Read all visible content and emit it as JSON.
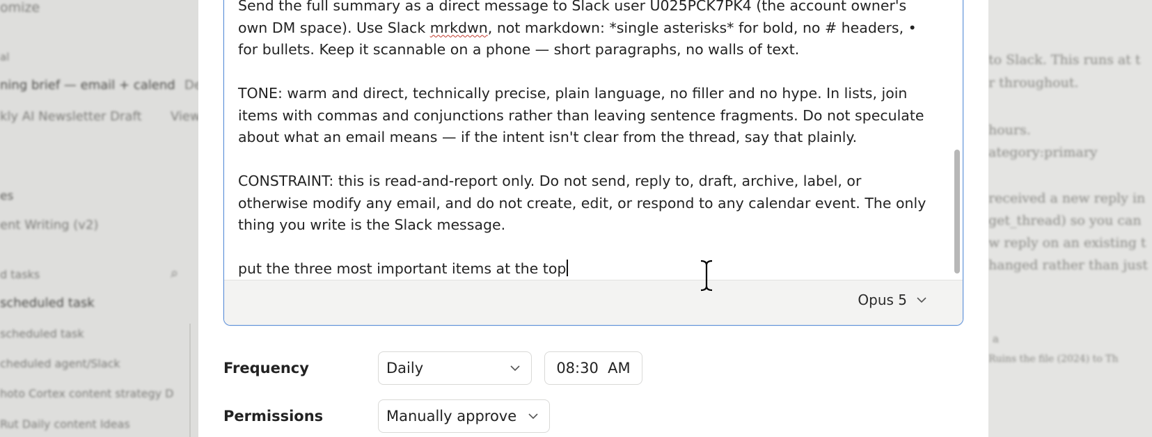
{
  "background": {
    "left_texts": [
      "omize",
      "al",
      "ning brief — email + calend",
      "De",
      "kly AI Newsletter Draft",
      "View",
      "es",
      "ent Writing (v2)",
      "d tasks",
      "scheduled task",
      "scheduled task",
      "cheduled agent/Slack",
      "hoto Cortex content strategy D",
      "Rut Daily content Ideas"
    ],
    "right_texts": [
      "to Slack. This runs at t",
      "r throughout.",
      "hours.",
      "ategory:primary",
      "received a new reply in",
      "get_thread) so you can",
      "w reply on an existing t",
      "hanged rather than just",
      "a",
      "Ruins the file (2024) to Th"
    ]
  },
  "editor": {
    "para1": "Send the full summary as a direct message to Slack user U025PCK7PK4 (the account owner's own DM space). Use Slack ",
    "para1_misspelled": "mrkdwn",
    "para1_rest": ", not markdown: *single asterisks* for bold, no # headers, • for bullets. Keep it scannable on a phone — short paragraphs, no walls of text.",
    "para2": "TONE: warm and direct, technically precise, plain language, no filler and no hype. In lists, join items with commas and conjunctions rather than leaving sentence fragments. Do not speculate about what an email means — if the intent isn't clear from the thread, say that plainly.",
    "para3": "CONSTRAINT: this is read-and-report only. Do not send, reply to, draft, archive, label, or otherwise modify any email, and do not create, edit, or respond to any calendar event. The only thing you write is the Slack message.",
    "para4": "put the three most important items at the top",
    "model": "Opus 5"
  },
  "form": {
    "frequency_label": "Frequency",
    "frequency_value": "Daily",
    "time_value": "08:30  AM",
    "permissions_label": "Permissions",
    "permissions_value": "Manually approve"
  }
}
